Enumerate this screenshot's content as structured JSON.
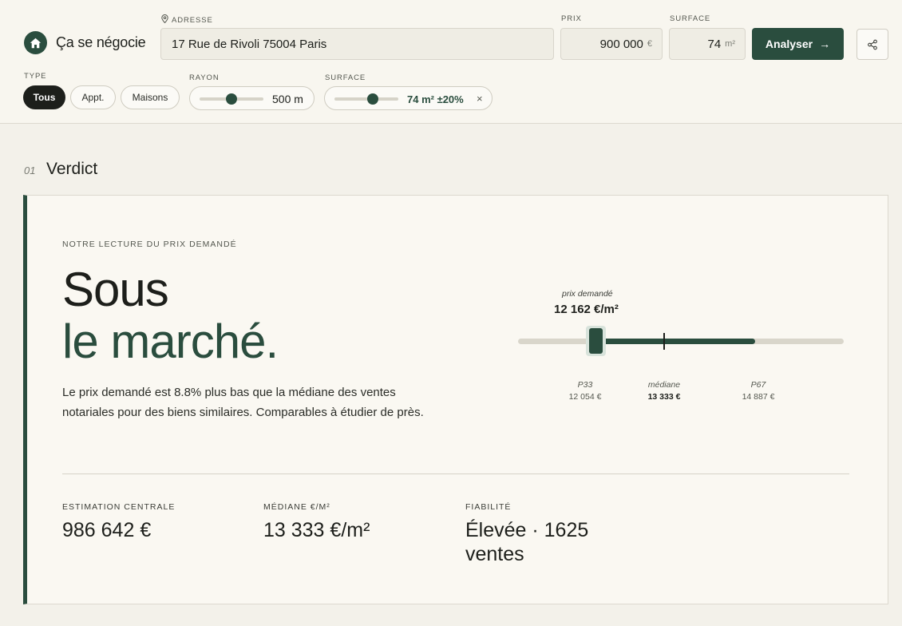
{
  "brand": {
    "name": "Ça se négocie",
    "logo_icon": "home-icon"
  },
  "search": {
    "address_label": "ADRESSE",
    "address_value": "17 Rue de Rivoli 75004 Paris",
    "price_label": "PRIX",
    "price_value": "900 000",
    "price_unit": "€",
    "surface_label": "SURFACE",
    "surface_value": "74",
    "surface_unit": "m²",
    "analyse_label": "Analyser",
    "analyse_arrow": "→",
    "share_icon": "share-icon"
  },
  "filters": {
    "type_label": "TYPE",
    "type_options": [
      "Tous",
      "Appt.",
      "Maisons"
    ],
    "type_selected": "Tous",
    "rayon_label": "RAYON",
    "rayon_value": "500 m",
    "rayon_level": 0.5,
    "surface_label": "SURFACE",
    "surface_value": "74 m² ±20%",
    "surface_level": 0.6,
    "surface_clear": "×"
  },
  "section": {
    "number": "01",
    "title": "Verdict"
  },
  "verdict": {
    "kicker": "NOTRE LECTURE DU PRIX DEMANDÉ",
    "line1": "Sous",
    "line2": "le marché.",
    "description": "Le prix demandé est 8.8% plus bas que la médiane des ventes notariales pour des biens similaires. Comparables à étudier de près.",
    "asked_label": "prix demandé",
    "asked_value": "12 162 €/m²",
    "ticks": [
      {
        "name": "P33",
        "value": "12 054 €"
      },
      {
        "name": "médiane",
        "value": "13 333 €"
      },
      {
        "name": "P67",
        "value": "14 887 €"
      }
    ]
  },
  "stats": [
    {
      "label": "ESTIMATION CENTRALE",
      "value": "986 642 €"
    },
    {
      "label": "MÉDIANE €/M²",
      "value": "13 333 €/m²"
    },
    {
      "label": "FIABILITÉ",
      "value": "Élevée · 1625 ventes"
    }
  ],
  "colors": {
    "accent": "#2a4d3e",
    "background": "#f3f1ea",
    "card": "#faf8f2"
  }
}
